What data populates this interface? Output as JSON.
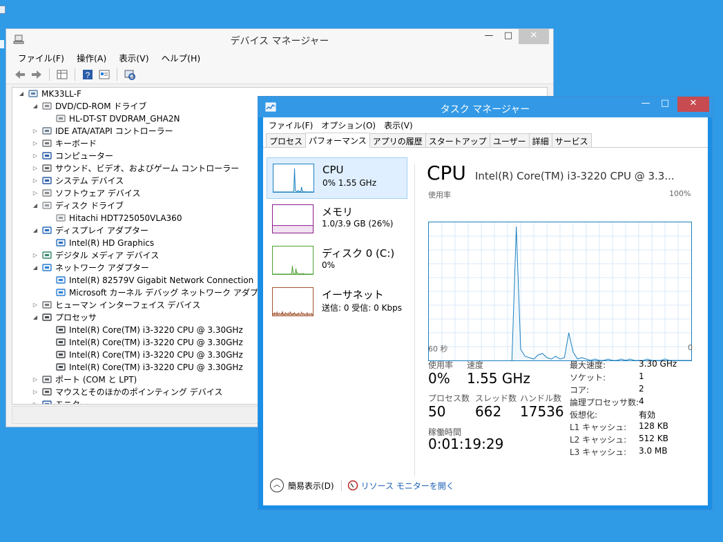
{
  "device_manager": {
    "title": "デバイス マネージャー",
    "menu": [
      "ファイル(F)",
      "操作(A)",
      "表示(V)",
      "ヘルプ(H)"
    ],
    "window_buttons": {
      "minimize": "—",
      "maximize": "□",
      "close": "✕"
    },
    "tree": [
      {
        "level": 0,
        "expander": "expanded",
        "icon": "computer-icon",
        "label": "MK33LL-F"
      },
      {
        "level": 1,
        "expander": "expanded",
        "icon": "optical-drive-icon",
        "label": "DVD/CD-ROM ドライブ"
      },
      {
        "level": 2,
        "expander": "none",
        "icon": "optical-drive-icon",
        "label": "HL-DT-ST DVDRAM_GHA2N"
      },
      {
        "level": 1,
        "expander": "collapsed",
        "icon": "ide-controller-icon",
        "label": "IDE ATA/ATAPI コントローラー"
      },
      {
        "level": 1,
        "expander": "collapsed",
        "icon": "keyboard-icon",
        "label": "キーボード"
      },
      {
        "level": 1,
        "expander": "collapsed",
        "icon": "monitor-icon",
        "label": "コンピューター"
      },
      {
        "level": 1,
        "expander": "collapsed",
        "icon": "speaker-icon",
        "label": "サウンド、ビデオ、およびゲーム コントローラー"
      },
      {
        "level": 1,
        "expander": "collapsed",
        "icon": "monitor-icon",
        "label": "システム デバイス"
      },
      {
        "level": 1,
        "expander": "collapsed",
        "icon": "software-device-icon",
        "label": "ソフトウェア デバイス"
      },
      {
        "level": 1,
        "expander": "expanded",
        "icon": "disk-drive-icon",
        "label": "ディスク ドライブ"
      },
      {
        "level": 2,
        "expander": "none",
        "icon": "disk-drive-icon",
        "label": "Hitachi HDT725050VLA360"
      },
      {
        "level": 1,
        "expander": "expanded",
        "icon": "display-adapter-icon",
        "label": "ディスプレイ アダプター"
      },
      {
        "level": 2,
        "expander": "none",
        "icon": "display-adapter-icon",
        "label": "Intel(R) HD Graphics"
      },
      {
        "level": 1,
        "expander": "collapsed",
        "icon": "media-device-icon",
        "label": "デジタル メディア デバイス"
      },
      {
        "level": 1,
        "expander": "expanded",
        "icon": "network-adapter-icon",
        "label": "ネットワーク アダプター"
      },
      {
        "level": 2,
        "expander": "none",
        "icon": "network-adapter-icon",
        "label": "Intel(R) 82579V Gigabit Network Connection"
      },
      {
        "level": 2,
        "expander": "none",
        "icon": "network-adapter-icon",
        "label": "Microsoft カーネル デバッグ ネットワーク アダプター"
      },
      {
        "level": 1,
        "expander": "collapsed",
        "icon": "hid-icon",
        "label": "ヒューマン インターフェイス デバイス"
      },
      {
        "level": 1,
        "expander": "expanded",
        "icon": "processor-icon",
        "label": "プロセッサ"
      },
      {
        "level": 2,
        "expander": "none",
        "icon": "processor-icon",
        "label": "Intel(R) Core(TM) i3-3220 CPU @ 3.30GHz"
      },
      {
        "level": 2,
        "expander": "none",
        "icon": "processor-icon",
        "label": "Intel(R) Core(TM) i3-3220 CPU @ 3.30GHz"
      },
      {
        "level": 2,
        "expander": "none",
        "icon": "processor-icon",
        "label": "Intel(R) Core(TM) i3-3220 CPU @ 3.30GHz"
      },
      {
        "level": 2,
        "expander": "none",
        "icon": "processor-icon",
        "label": "Intel(R) Core(TM) i3-3220 CPU @ 3.30GHz"
      },
      {
        "level": 1,
        "expander": "collapsed",
        "icon": "port-icon",
        "label": "ポート (COM と LPT)"
      },
      {
        "level": 1,
        "expander": "collapsed",
        "icon": "mouse-icon",
        "label": "マウスとそのほかのポインティング デバイス"
      },
      {
        "level": 1,
        "expander": "collapsed",
        "icon": "monitor-icon",
        "label": "モニター"
      }
    ]
  },
  "task_manager": {
    "title": "タスク マネージャー",
    "window_buttons": {
      "minimize": "—",
      "maximize": "□",
      "close": "✕"
    },
    "menu": [
      "ファイル(F)",
      "オプション(O)",
      "表示(V)"
    ],
    "tabs": [
      "プロセス",
      "パフォーマンス",
      "アプリの履歴",
      "スタートアップ",
      "ユーザー",
      "詳細",
      "サービス"
    ],
    "active_tab": "パフォーマンス",
    "resources": [
      {
        "name": "CPU",
        "sub": "0% 1.55 GHz",
        "color": "#1a7fbf",
        "selected": true
      },
      {
        "name": "メモリ",
        "sub": "1.0/3.9 GB (26%)",
        "color": "#8b1a8b",
        "selected": false
      },
      {
        "name": "ディスク 0 (C:)",
        "sub": "0%",
        "color": "#4da033",
        "selected": false
      },
      {
        "name": "イーサネット",
        "sub": "送信: 0 受信: 0 Kbps",
        "color": "#a0522d",
        "selected": false
      }
    ],
    "detail": {
      "heading": "CPU",
      "model": "Intel(R) Core(TM) i3-3220 CPU @ 3.3...",
      "y_label": "使用率",
      "y_max_label": "100%",
      "x_left_label": "60 秒",
      "x_right_label": "0"
    },
    "stats": {
      "utilization": {
        "label": "使用率",
        "value": "0%"
      },
      "speed": {
        "label": "速度",
        "value": "1.55 GHz"
      },
      "processes": {
        "label": "プロセス数",
        "value": "50"
      },
      "threads": {
        "label": "スレッド数",
        "value": "662"
      },
      "handles": {
        "label": "ハンドル数",
        "value": "17536"
      },
      "uptime": {
        "label": "稼働時間",
        "value": "0:01:19:29"
      }
    },
    "right_stats": [
      {
        "label": "最大速度:",
        "value": "3.30 GHz"
      },
      {
        "label": "ソケット:",
        "value": "1"
      },
      {
        "label": "コア:",
        "value": "2"
      },
      {
        "label": "論理プロセッサ数:",
        "value": "4"
      },
      {
        "label": "仮想化:",
        "value": "有効"
      },
      {
        "label": "L1 キャッシュ:",
        "value": "128 KB"
      },
      {
        "label": "L2 キャッシュ:",
        "value": "512 KB"
      },
      {
        "label": "L3 キャッシュ:",
        "value": "3.0 MB"
      }
    ],
    "footer": {
      "fewer_details": "簡易表示(D)",
      "resource_monitor": "リソース モニターを開く"
    },
    "chart_data": {
      "type": "line",
      "title": "",
      "xlabel": "",
      "ylabel": "使用率",
      "xlim": [
        60,
        0
      ],
      "ylim": [
        0,
        100
      ],
      "grid": true,
      "series": [
        {
          "color": "#1a7fbf",
          "x": [
            60,
            59,
            58,
            57,
            56,
            55,
            54,
            53,
            52,
            51,
            50,
            49,
            48,
            47,
            46,
            45,
            44,
            43,
            42,
            41,
            40,
            39,
            38,
            37,
            36,
            35,
            34,
            33,
            32,
            31,
            30,
            29,
            28,
            27,
            26,
            25,
            24,
            23,
            22,
            21,
            20,
            19,
            18,
            17,
            16,
            15,
            14,
            13,
            12,
            11,
            10,
            9,
            8,
            7,
            6,
            5,
            4,
            3,
            2,
            1,
            0
          ],
          "values": [
            null,
            null,
            null,
            null,
            null,
            null,
            null,
            null,
            null,
            null,
            null,
            null,
            null,
            null,
            null,
            null,
            null,
            null,
            null,
            0,
            97,
            8,
            3,
            2,
            1,
            4,
            5,
            2,
            1,
            3,
            1,
            2,
            20,
            6,
            1,
            2,
            1,
            0,
            1,
            0,
            0,
            1,
            0,
            0,
            1,
            0,
            1,
            0,
            0,
            0,
            1,
            0,
            0,
            0,
            1,
            0,
            0,
            0,
            0,
            0,
            0
          ]
        }
      ]
    },
    "thumbnails": {
      "cpu": [
        0,
        0,
        0,
        0,
        0,
        0,
        0,
        0,
        0,
        0,
        0,
        0,
        0,
        0,
        0,
        0,
        0,
        0,
        0,
        0,
        0,
        0,
        0,
        0,
        0,
        0,
        0,
        0,
        0,
        0,
        5,
        85,
        8,
        3,
        2,
        1,
        5,
        2,
        1,
        2,
        1,
        18,
        4,
        1,
        1,
        0,
        1,
        0,
        0,
        1,
        0,
        0,
        0,
        0,
        1,
        0,
        0,
        0,
        0,
        0
      ],
      "memory": [
        26,
        26,
        26,
        26,
        26,
        26,
        26,
        26,
        26,
        26,
        26,
        26,
        26,
        26,
        26,
        26,
        26,
        26,
        26,
        26,
        26,
        26,
        26,
        26,
        26,
        26,
        26,
        26,
        26,
        26,
        26,
        26,
        26,
        26,
        26,
        26,
        26,
        26,
        26,
        26,
        26,
        26,
        26,
        26,
        26,
        26,
        26,
        26,
        26,
        26,
        26,
        26,
        26,
        26,
        26,
        26,
        26,
        26,
        26,
        26
      ],
      "disk": [
        0,
        0,
        0,
        0,
        0,
        0,
        0,
        0,
        0,
        0,
        0,
        0,
        0,
        0,
        0,
        0,
        0,
        0,
        0,
        0,
        0,
        0,
        0,
        0,
        0,
        0,
        0,
        0,
        2,
        30,
        4,
        2,
        1,
        0,
        20,
        3,
        5,
        1,
        0,
        0,
        2,
        1,
        0,
        0,
        3,
        1,
        0,
        0,
        0,
        1,
        0,
        0,
        0,
        0,
        0,
        0,
        0,
        0,
        0,
        0
      ],
      "ethernet": [
        0,
        4,
        8,
        2,
        10,
        5,
        3,
        12,
        2,
        6,
        9,
        3,
        4,
        8,
        2,
        15,
        3,
        5,
        2,
        10,
        4,
        6,
        3,
        9,
        2,
        5,
        14,
        3,
        6,
        2,
        8,
        4,
        10,
        3,
        5,
        2,
        7,
        3,
        9,
        4,
        2,
        6,
        12,
        3,
        5,
        8,
        2,
        4,
        6,
        3,
        10,
        2,
        5,
        7,
        3,
        4,
        8,
        2,
        5,
        3
      ]
    }
  }
}
